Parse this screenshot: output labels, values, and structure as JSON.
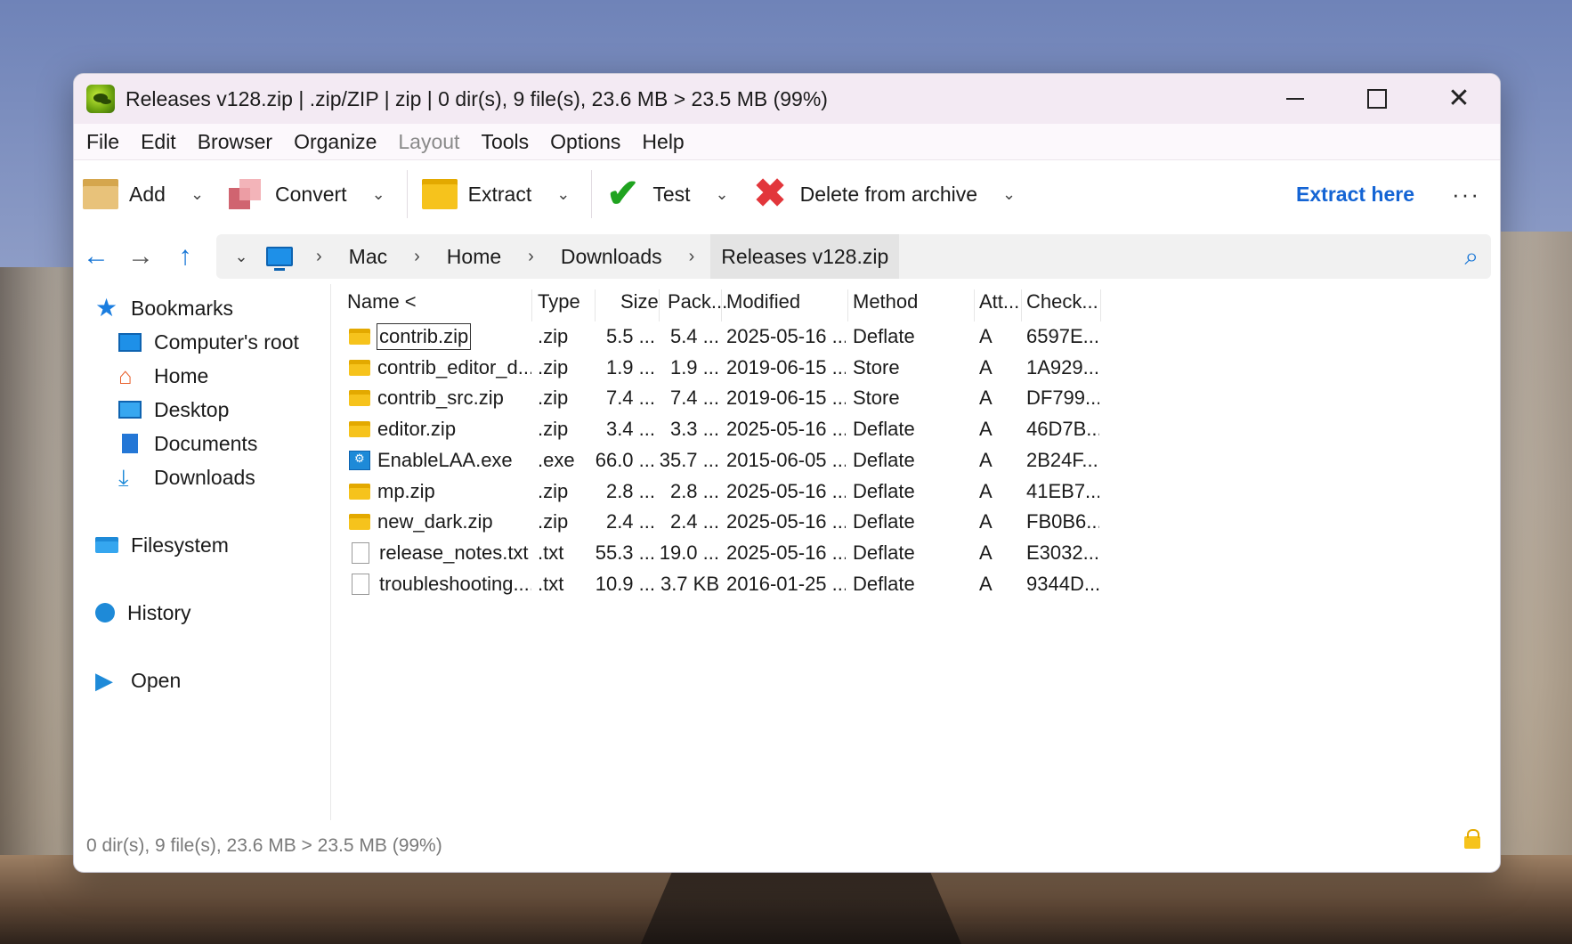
{
  "window": {
    "title": "Releases v128.zip | .zip/ZIP | zip | 0 dir(s), 9 file(s), 23.6 MB > 23.5 MB (99%)",
    "controls": {
      "minimize": "minimize",
      "maximize": "maximize",
      "close": "✕"
    }
  },
  "menu": [
    {
      "label": "File",
      "enabled": true
    },
    {
      "label": "Edit",
      "enabled": true
    },
    {
      "label": "Browser",
      "enabled": true
    },
    {
      "label": "Organize",
      "enabled": true
    },
    {
      "label": "Layout",
      "enabled": false
    },
    {
      "label": "Tools",
      "enabled": true
    },
    {
      "label": "Options",
      "enabled": true
    },
    {
      "label": "Help",
      "enabled": true
    }
  ],
  "toolbar": {
    "add": "Add",
    "convert": "Convert",
    "extract": "Extract",
    "test": "Test",
    "delete": "Delete from archive",
    "extract_here": "Extract here",
    "more": "···"
  },
  "nav": {
    "back": "←",
    "forward": "→",
    "up": "↑",
    "breadcrumbs": [
      "Mac",
      "Home",
      "Downloads",
      "Releases v128.zip"
    ]
  },
  "sidebar": {
    "bookmarks": "Bookmarks",
    "items": [
      "Computer's root",
      "Home",
      "Desktop",
      "Documents",
      "Downloads"
    ],
    "filesystem": "Filesystem",
    "history": "History",
    "open": "Open"
  },
  "columns": {
    "name": "Name <",
    "type": "Type",
    "size": "Size",
    "packed": "Pack...",
    "modified": "Modified",
    "method": "Method",
    "attr": "Att...",
    "checksum": "Check..."
  },
  "files": [
    {
      "name": "contrib.zip",
      "type": ".zip",
      "size": "5.5 ...",
      "packed": "5.4 ...",
      "modified": "2025-05-16 ...",
      "method": "Deflate",
      "attr": "A",
      "checksum": "6597E...",
      "icon": "zip"
    },
    {
      "name": "contrib_editor_d...",
      "type": ".zip",
      "size": "1.9 ...",
      "packed": "1.9 ...",
      "modified": "2019-06-15 ...",
      "method": "Store",
      "attr": "A",
      "checksum": "1A929...",
      "icon": "zip"
    },
    {
      "name": "contrib_src.zip",
      "type": ".zip",
      "size": "7.4 ...",
      "packed": "7.4 ...",
      "modified": "2019-06-15 ...",
      "method": "Store",
      "attr": "A",
      "checksum": "DF799...",
      "icon": "zip"
    },
    {
      "name": "editor.zip",
      "type": ".zip",
      "size": "3.4 ...",
      "packed": "3.3 ...",
      "modified": "2025-05-16 ...",
      "method": "Deflate",
      "attr": "A",
      "checksum": "46D7B...",
      "icon": "zip"
    },
    {
      "name": "EnableLAA.exe",
      "type": ".exe",
      "size": "66.0 ...",
      "packed": "35.7 ...",
      "modified": "2015-06-05 ...",
      "method": "Deflate",
      "attr": "A",
      "checksum": "2B24F...",
      "icon": "exe"
    },
    {
      "name": "mp.zip",
      "type": ".zip",
      "size": "2.8 ...",
      "packed": "2.8 ...",
      "modified": "2025-05-16 ...",
      "method": "Deflate",
      "attr": "A",
      "checksum": "41EB7...",
      "icon": "zip"
    },
    {
      "name": "new_dark.zip",
      "type": ".zip",
      "size": "2.4 ...",
      "packed": "2.4 ...",
      "modified": "2025-05-16 ...",
      "method": "Deflate",
      "attr": "A",
      "checksum": "FB0B6...",
      "icon": "zip"
    },
    {
      "name": "release_notes.txt",
      "type": ".txt",
      "size": "55.3 ...",
      "packed": "19.0 ...",
      "modified": "2025-05-16 ...",
      "method": "Deflate",
      "attr": "A",
      "checksum": "E3032...",
      "icon": "txt"
    },
    {
      "name": "troubleshooting....",
      "type": ".txt",
      "size": "10.9 ...",
      "packed": "3.7 KB",
      "modified": "2016-01-25 ...",
      "method": "Deflate",
      "attr": "A",
      "checksum": "9344D...",
      "icon": "txt"
    }
  ],
  "status": {
    "text": "0 dir(s), 9 file(s), 23.6 MB > 23.5 MB (99%)"
  }
}
